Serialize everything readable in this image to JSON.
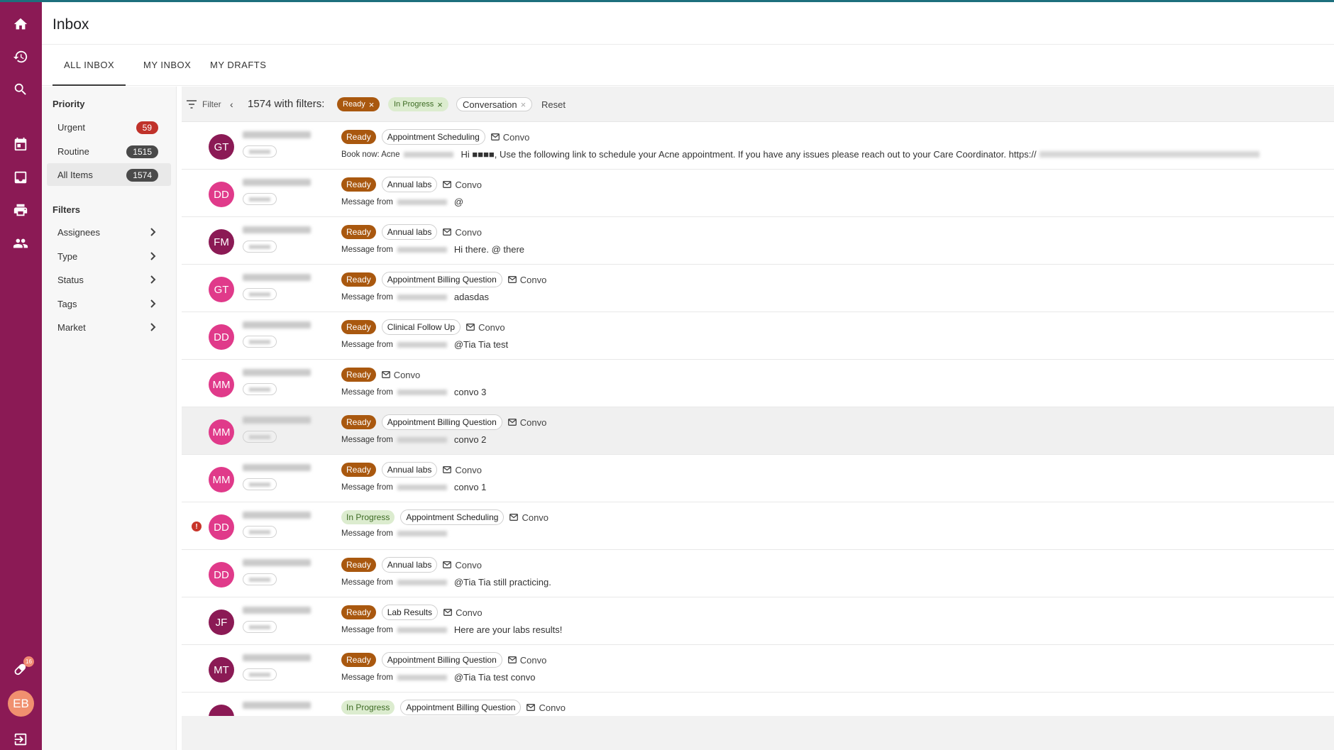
{
  "app": {
    "title": "Inbox",
    "accent": "#8b1a55",
    "notification_count": "16",
    "user_initials": "EB"
  },
  "rail_icons": [
    "home-icon",
    "history-icon",
    "search-icon",
    "calendar-icon",
    "inbox-icon",
    "print-icon",
    "people-icon",
    "pill-icon",
    "logout-icon"
  ],
  "tabs": [
    {
      "label": "ALL INBOX",
      "active": true
    },
    {
      "label": "MY INBOX",
      "active": false
    },
    {
      "label": "MY DRAFTS",
      "active": false
    }
  ],
  "sidebar": {
    "priority_heading": "Priority",
    "priority": [
      {
        "label": "Urgent",
        "count": "59",
        "color": "#c0322a"
      },
      {
        "label": "Routine",
        "count": "1515",
        "color": "#4a4a4a"
      },
      {
        "label": "All Items",
        "count": "1574",
        "color": "#4a4a4a"
      }
    ],
    "filters_heading": "Filters",
    "filters": [
      "Assignees",
      "Type",
      "Status",
      "Tags",
      "Market"
    ]
  },
  "filterbar": {
    "filter_label": "Filter",
    "back_label": "‹",
    "count_text": "1574 with filters:",
    "chips": [
      {
        "label": "Ready",
        "style": "ready"
      },
      {
        "label": "In Progress",
        "style": "progress"
      },
      {
        "label": "Conversation",
        "style": "convo"
      }
    ],
    "chip_remove": "×",
    "reset": "Reset"
  },
  "channel_label": "Convo",
  "rows": [
    {
      "initials": "GT",
      "avatar_color": "#8b1a55",
      "status": "Ready",
      "tag": "Appointment Scheduling",
      "prefix": "Book now: Acne",
      "message": "Hi ■■■■, Use the following link to schedule your Acne appointment. If you have any issues please reach out to your Care Coordinator. https://"
    },
    {
      "initials": "DD",
      "avatar_color": "#e03a8a",
      "status": "Ready",
      "tag": "Annual labs",
      "prefix": "Message from",
      "message": "@"
    },
    {
      "initials": "FM",
      "avatar_color": "#8b1a55",
      "status": "Ready",
      "tag": "Annual labs",
      "prefix": "Message from",
      "message": "Hi there. @                  there"
    },
    {
      "initials": "GT",
      "avatar_color": "#e03a8a",
      "status": "Ready",
      "tag": "Appointment Billing Question",
      "prefix": "Message from",
      "message": "adasdas"
    },
    {
      "initials": "DD",
      "avatar_color": "#e03a8a",
      "status": "Ready",
      "tag": "Clinical Follow Up",
      "prefix": "Message from",
      "message": "@Tia Tia test"
    },
    {
      "initials": "MM",
      "avatar_color": "#e03a8a",
      "status": "Ready",
      "tag": "",
      "prefix": "Message from",
      "message": "convo 3"
    },
    {
      "initials": "MM",
      "avatar_color": "#e03a8a",
      "status": "Ready",
      "tag": "Appointment Billing Question",
      "prefix": "Message from",
      "message": "convo 2",
      "selected": true
    },
    {
      "initials": "MM",
      "avatar_color": "#e03a8a",
      "status": "Ready",
      "tag": "Annual labs",
      "prefix": "Message from",
      "message": "convo 1"
    },
    {
      "initials": "DD",
      "avatar_color": "#e03a8a",
      "status": "In Progress",
      "tag": "Appointment Scheduling",
      "prefix": "Message from",
      "message": "",
      "alert": "!"
    },
    {
      "initials": "DD",
      "avatar_color": "#e03a8a",
      "status": "Ready",
      "tag": "Annual labs",
      "prefix": "Message from",
      "message": "@Tia Tia still practicing."
    },
    {
      "initials": "JF",
      "avatar_color": "#8b1a55",
      "status": "Ready",
      "tag": "Lab Results",
      "prefix": "Message from",
      "message": "Here are your labs results!"
    },
    {
      "initials": "MT",
      "avatar_color": "#8b1a55",
      "status": "Ready",
      "tag": "Appointment Billing Question",
      "prefix": "Message from",
      "message": "@Tia Tia test convo"
    },
    {
      "initials": "",
      "avatar_color": "#8b1a55",
      "status": "In Progress",
      "tag": "Appointment Billing Question",
      "prefix": "",
      "message": ""
    }
  ]
}
